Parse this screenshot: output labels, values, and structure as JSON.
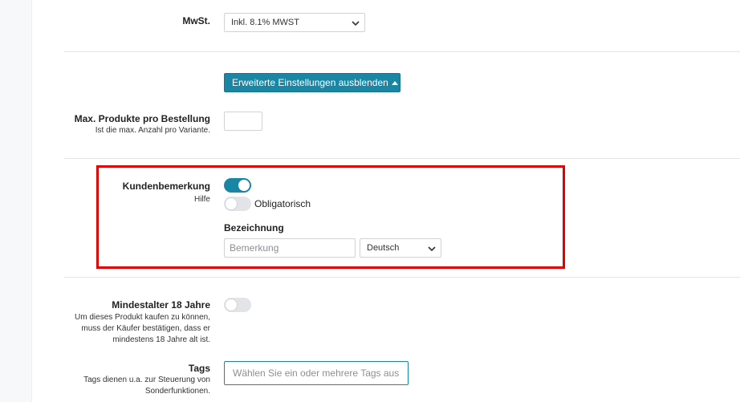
{
  "vat": {
    "label": "MwSt.",
    "selected": "Inkl. 8.1% MWST"
  },
  "advanced_button": {
    "label": "Erweiterte Einstellungen ausblenden"
  },
  "max_products": {
    "label": "Max. Produkte pro Bestellung",
    "help": "Ist die max. Anzahl pro Variante.",
    "value": ""
  },
  "customer_note": {
    "label": "Kundenbemerkung",
    "help": "Hilfe",
    "enabled": true,
    "mandatory_label": "Obligatorisch",
    "mandatory": false,
    "designation_label": "Bezeichnung",
    "designation_placeholder": "Bemerkung",
    "language_selected": "Deutsch"
  },
  "min_age": {
    "label": "Mindestalter 18 Jahre",
    "help": "Um dieses Produkt kaufen zu können, muss der Käufer bestätigen, dass er mindestens 18 Jahre alt ist.",
    "enabled": false
  },
  "tags": {
    "label": "Tags",
    "help": "Tags dienen u.a. zur Steuerung von Sonderfunktionen.",
    "placeholder": "Wählen Sie ein oder mehrere Tags aus"
  },
  "colors": {
    "accent": "#1a86a6",
    "highlight": "#e00000"
  }
}
